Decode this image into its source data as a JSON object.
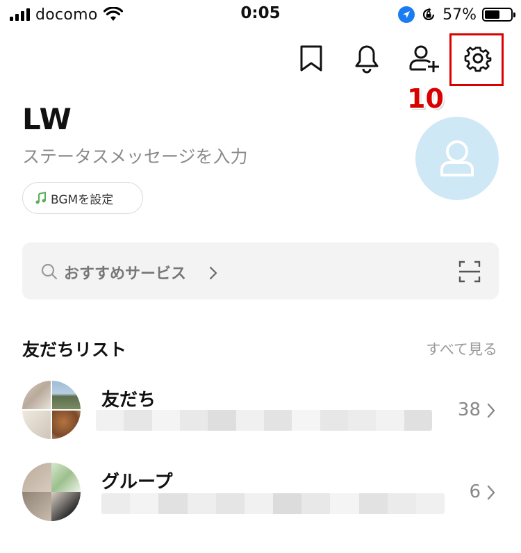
{
  "status_bar": {
    "carrier": "docomo",
    "time": "0:05",
    "battery_percent": "57%",
    "battery_level": 0.57
  },
  "header": {
    "icons": [
      "bookmark-icon",
      "bell-icon",
      "add-friend-icon",
      "gear-icon"
    ],
    "highlight_color": "#d90000"
  },
  "annotation": {
    "step_number": "10"
  },
  "profile": {
    "name": "LW",
    "status_placeholder": "ステータスメッセージを入力",
    "bgm_label": "BGMを設定",
    "avatar_color": "#cfe8f6"
  },
  "search": {
    "label": "おすすめサービス"
  },
  "friends_section": {
    "title": "友だちリスト",
    "see_all": "すべて見る",
    "rows": [
      {
        "title": "友だち",
        "count": "38"
      },
      {
        "title": "グループ",
        "count": "6"
      }
    ]
  },
  "colors": {
    "accent_green": "#5ab05a",
    "muted_text": "#8a8a8a",
    "search_bg": "#f3f3f3"
  }
}
